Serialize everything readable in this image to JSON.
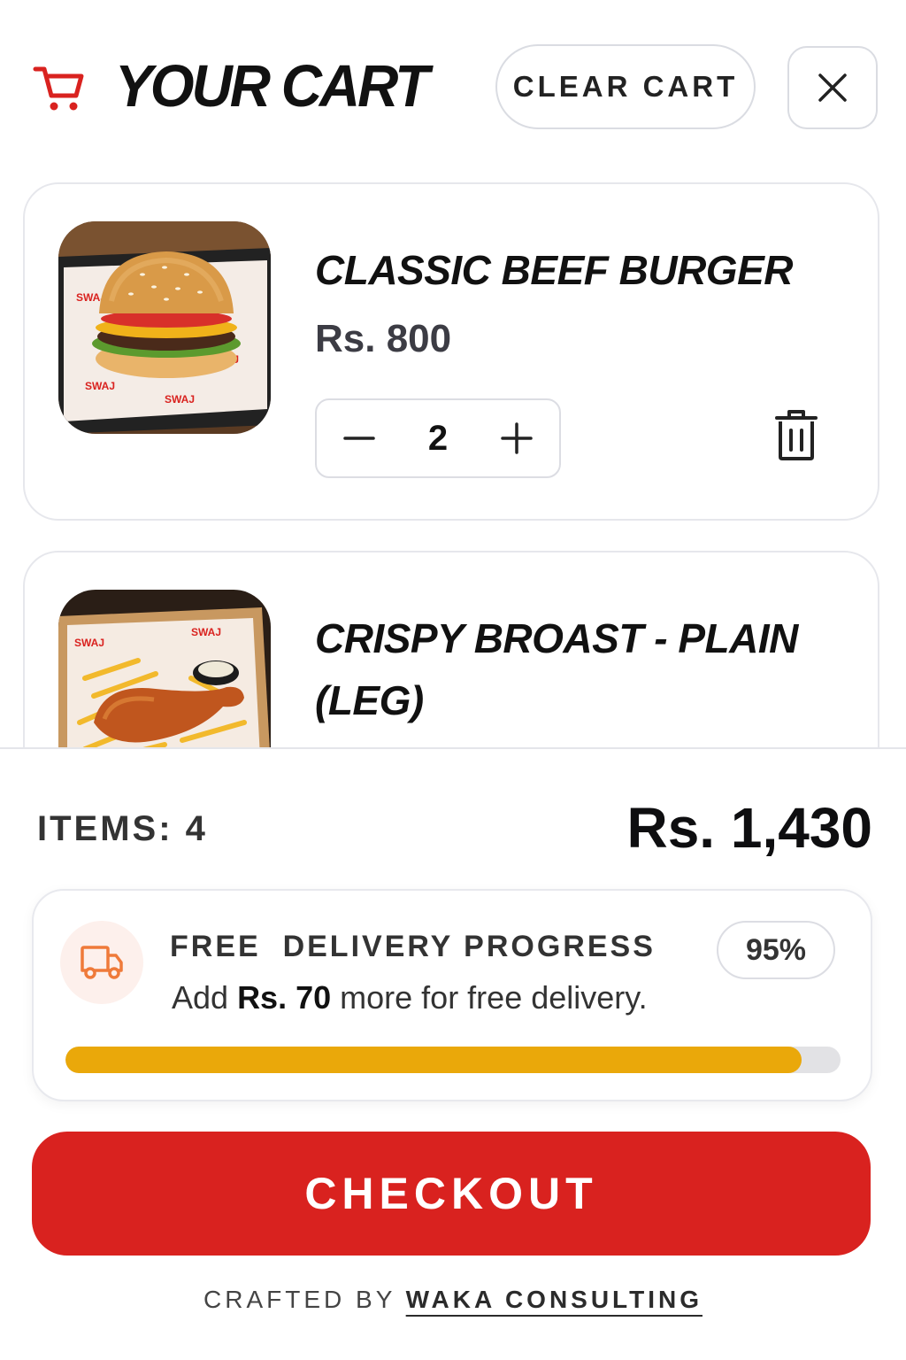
{
  "header": {
    "title": "YOUR CART",
    "cart_icon": "shopping-cart-icon",
    "clear_label": "CLEAR CART",
    "close_icon": "close-icon"
  },
  "items": [
    {
      "name": "CLASSIC BEEF BURGER",
      "price": "Rs. 800",
      "quantity": "2",
      "image": "burger-photo"
    },
    {
      "name": "CRISPY BROAST - PLAIN (LEG)",
      "image": "fried-chicken-photo"
    }
  ],
  "summary": {
    "items_label": "ITEMS: 4",
    "total": "Rs. 1,430"
  },
  "delivery": {
    "icon": "truck-icon",
    "title": "FREE  DELIVERY PROGRESS",
    "msg_prefix": "Add ",
    "msg_amount": "Rs. 70",
    "msg_suffix": " more for free delivery.",
    "percent_label": "95%",
    "progress": 0.95
  },
  "checkout_label": "CHECKOUT",
  "footer": {
    "prefix": "CRAFTED BY ",
    "link": "WAKA CONSULTING"
  },
  "colors": {
    "brand_red": "#d9221f",
    "progress_fill": "#eaa80a",
    "progress_track": "#e2e2e5"
  }
}
